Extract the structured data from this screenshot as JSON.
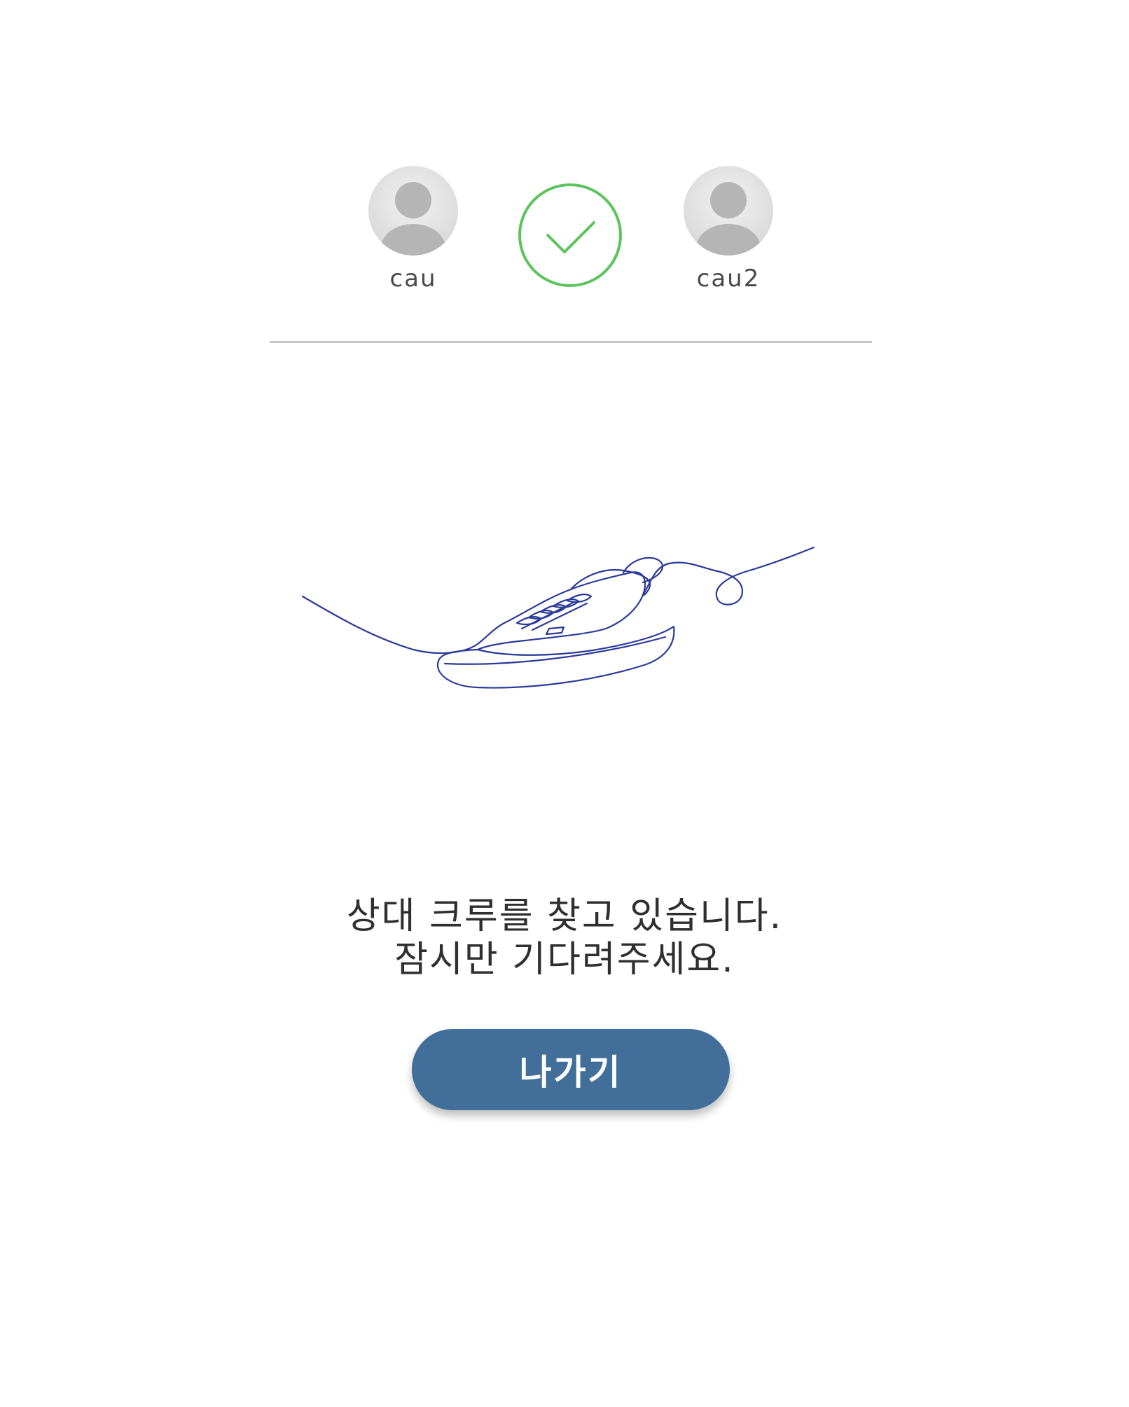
{
  "players": {
    "left": {
      "name": "cau",
      "avatar_icon": "user-avatar-icon"
    },
    "right": {
      "name": "cau2",
      "avatar_icon": "user-avatar-icon"
    }
  },
  "status": {
    "icon": "check-circle-icon",
    "color": "#5cc45c"
  },
  "illustration": {
    "icon": "sneaker-line-drawing",
    "stroke_color": "#2a3a9a"
  },
  "message": {
    "line1": "상대 크루를 찾고 있습니다.",
    "line2": "잠시만 기다려주세요."
  },
  "exit_button": {
    "label": "나가기",
    "color": "#416f99"
  }
}
